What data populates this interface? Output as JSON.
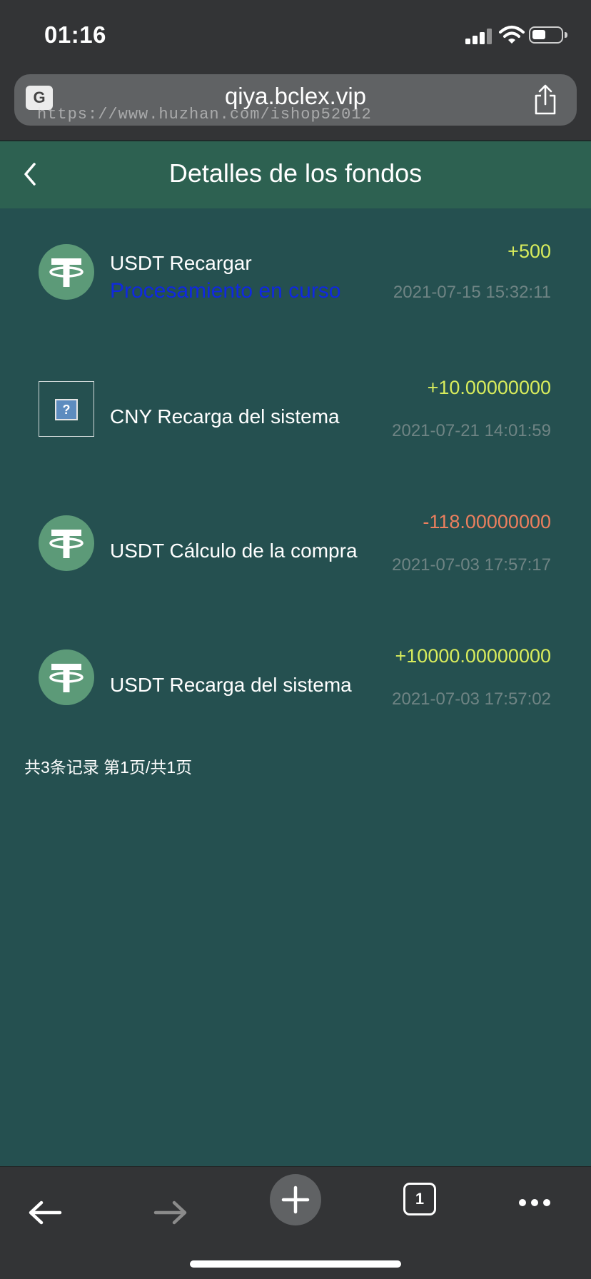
{
  "status_bar": {
    "time": "01:16"
  },
  "browser": {
    "url": "qiya.bclex.vip",
    "watermark": "https://www.huzhan.com/ishop52012",
    "translate_label": "G",
    "tab_count": "1"
  },
  "header": {
    "title": "Detalles de los fondos"
  },
  "records": [
    {
      "icon": "tether-icon",
      "label": "USDT Recargar",
      "status": "Procesamiento en curso",
      "amount": "+500",
      "date": "2021-07-15 15:32:11"
    },
    {
      "icon": "unknown-image-icon",
      "label": "CNY Recarga del sistema",
      "amount": "+10.00000000",
      "date": "2021-07-21 14:01:59"
    },
    {
      "icon": "tether-icon",
      "label": "USDT Cálculo de la compra",
      "amount": "-118.00000000",
      "date": "2021-07-03 17:57:17"
    },
    {
      "icon": "tether-icon",
      "label": "USDT Recarga del sistema",
      "amount": "+10000.00000000",
      "date": "2021-07-03 17:57:02"
    }
  ],
  "pagination": {
    "summary": "共3条记录 第1页/共1页"
  },
  "colors": {
    "positive": "#d8ec5c",
    "negative": "#ec7f5e",
    "status": "#0f28e0",
    "background": "#255050",
    "header": "#2d6151"
  }
}
